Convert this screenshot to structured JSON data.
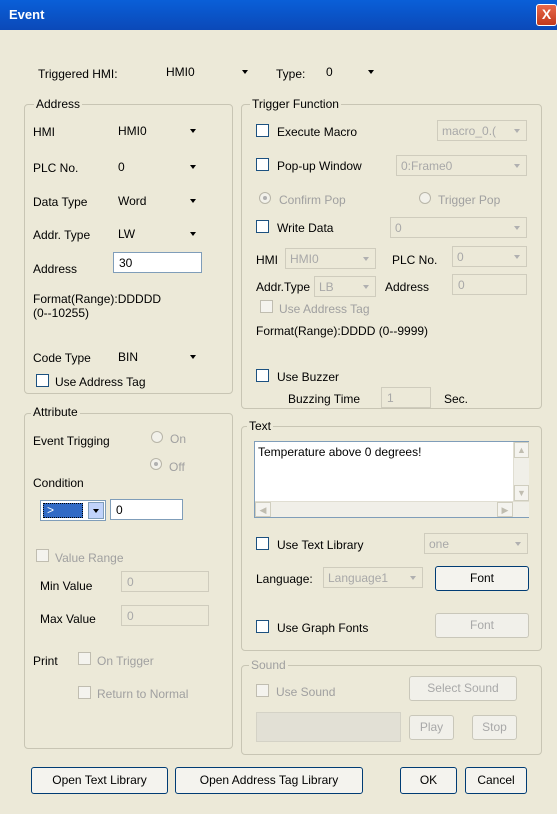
{
  "window": {
    "title": "Event",
    "close_glyph": "X"
  },
  "top": {
    "triggered_hmi_label": "Triggered HMI:",
    "triggered_hmi_value": "HMI0",
    "type_label": "Type:",
    "type_value": "0"
  },
  "address": {
    "title": "Address",
    "hmi_label": "HMI",
    "hmi_value": "HMI0",
    "plc_label": "PLC No.",
    "plc_value": "0",
    "data_type_label": "Data Type",
    "data_type_value": "Word",
    "addr_type_label": "Addr. Type",
    "addr_type_value": "LW",
    "address_label": "Address",
    "address_value": "30",
    "format_line1": "Format(Range):DDDDD",
    "format_line2": "(0--10255)",
    "code_type_label": "Code Type",
    "code_type_value": "BIN",
    "use_address_tag_label": "Use Address Tag"
  },
  "attribute": {
    "title": "Attribute",
    "event_trigging_label": "Event Trigging",
    "on_label": "On",
    "off_label": "Off",
    "condition_label": "Condition",
    "condition_op": ">",
    "condition_value": "0",
    "value_range_label": "Value Range",
    "min_label": "Min Value",
    "min_value": "0",
    "max_label": "Max Value",
    "max_value": "0",
    "print_label": "Print",
    "on_trigger_label": "On Trigger",
    "return_normal_label": "Return to Normal"
  },
  "trigger": {
    "title": "Trigger Function",
    "execute_macro_label": "Execute Macro",
    "macro_value": "macro_0.(",
    "popup_label": "Pop-up Window",
    "popup_value": "0:Frame0",
    "confirm_pop_label": "Confirm Pop",
    "trigger_pop_label": "Trigger Pop",
    "write_data_label": "Write Data",
    "write_data_value": "0",
    "hmi_label": "HMI",
    "hmi_value": "HMI0",
    "plc_label": "PLC No.",
    "plc_value": "0",
    "addr_type_label": "Addr.Type",
    "addr_type_value": "LB",
    "address_label": "Address",
    "address_value": "0",
    "use_address_tag_label": "Use Address Tag",
    "format_text": "Format(Range):DDDD (0--9999)",
    "use_buzzer_label": "Use Buzzer",
    "buzzing_time_label": "Buzzing Time",
    "buzzing_time_value": "1",
    "sec_label": "Sec."
  },
  "text_section": {
    "title": "Text",
    "content": "Temperature above 0 degrees!",
    "use_text_library_label": "Use Text Library",
    "library_value": "one",
    "language_label": "Language:",
    "language_value": "Language1",
    "font_button": "Font",
    "use_graph_fonts_label": "Use Graph Fonts",
    "font_button2": "Font"
  },
  "sound": {
    "title": "Sound",
    "use_sound_label": "Use Sound",
    "select_sound_button": "Select Sound",
    "play_button": "Play",
    "stop_button": "Stop"
  },
  "footer": {
    "open_text_library": "Open Text Library",
    "open_address_tag_library": "Open Address Tag Library",
    "ok": "OK",
    "cancel": "Cancel"
  },
  "colors": {
    "title_bar": "#0b56c8",
    "dialog_bg": "#ece9d8",
    "close_button": "#d4502f",
    "selection": "#316ac5"
  }
}
